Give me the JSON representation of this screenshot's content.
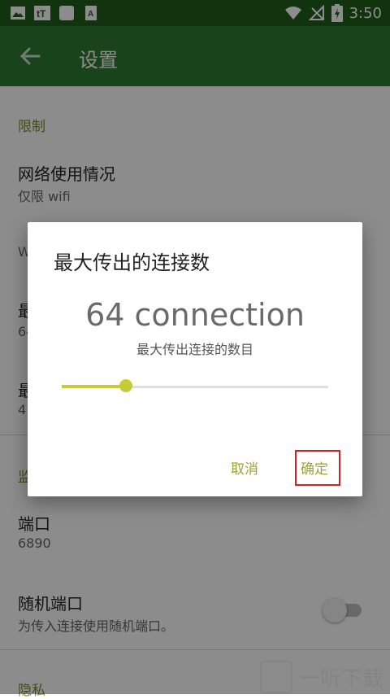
{
  "status_bar": {
    "time": "3:50",
    "icons_left": [
      "image-icon",
      "tt-app-icon",
      "square-app-icon",
      "font-app-icon"
    ],
    "icons_right": [
      "wifi-icon",
      "signal-off-icon",
      "battery-charging-icon"
    ]
  },
  "app_bar": {
    "title": "设置",
    "back_icon": "back-arrow-icon"
  },
  "settings": {
    "category1": "限制",
    "network_title": "网络使用情况",
    "network_summary": "仅限 wifi",
    "hidden_w": "W",
    "hidden_max1_title": "最",
    "hidden_max1_summary": "64",
    "hidden_max2_title": "最",
    "hidden_max2_summary": "4",
    "category2_partial": "监",
    "port_title": "端口",
    "port_value": "6890",
    "random_port_title": "随机端口",
    "random_port_summary": "为传入连接使用随机端口。",
    "random_port_enabled": false,
    "category3": "隐私"
  },
  "dialog": {
    "title": "最大传出的连接数",
    "value_text": "64 connection",
    "subtitle": "最大传出连接的数目",
    "slider_fraction": 0.24,
    "cancel_label": "取消",
    "ok_label": "确定"
  },
  "colors": {
    "status_bar": "#1f5d1a",
    "app_bar": "#2e7d32",
    "accent": "#c5cc37",
    "highlight": "#e11b1b"
  },
  "watermark": {
    "text": "一听下载"
  }
}
